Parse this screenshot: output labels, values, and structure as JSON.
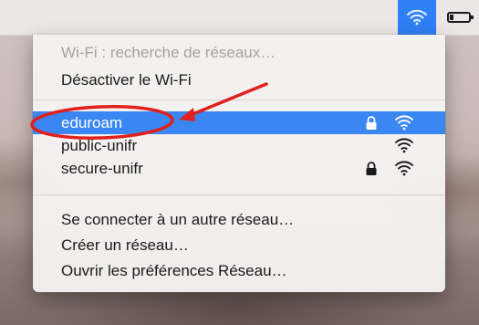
{
  "menubar": {
    "wifi_icon": "wifi-icon",
    "battery_icon": "battery-icon"
  },
  "wifi_menu": {
    "status": "Wi-Fi : recherche de réseaux…",
    "toggle_label": "Désactiver le Wi-Fi",
    "networks": [
      {
        "name": "eduroam",
        "secured": true,
        "selected": true
      },
      {
        "name": "public-unifr",
        "secured": false,
        "selected": false
      },
      {
        "name": "secure-unifr",
        "secured": true,
        "selected": false
      }
    ],
    "actions": [
      "Se connecter à un autre réseau…",
      "Créer un réseau…",
      "Ouvrir les préférences Réseau…"
    ]
  },
  "annotation": {
    "color": "#e0201c"
  },
  "colors": {
    "selection": "#3a87f4",
    "menubar_highlight": "#2f7ff5"
  }
}
